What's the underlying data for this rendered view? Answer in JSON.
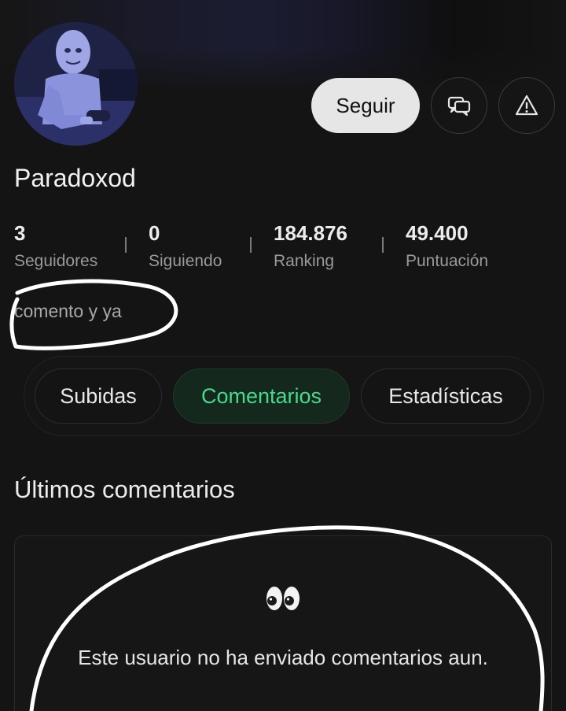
{
  "profile": {
    "username": "Paradoxod",
    "bio": "comento y ya",
    "follow_label": "Seguir"
  },
  "stats": [
    {
      "value": "3",
      "label": "Seguidores"
    },
    {
      "value": "0",
      "label": "Siguiendo"
    },
    {
      "value": "184.876",
      "label": "Ranking"
    },
    {
      "value": "49.400",
      "label": "Puntuación"
    }
  ],
  "tabs": [
    {
      "label": "Subidas",
      "active": false
    },
    {
      "label": "Comentarios",
      "active": true
    },
    {
      "label": "Estadísticas",
      "active": false
    }
  ],
  "comments": {
    "title": "Últimos comentarios",
    "empty_icon": "eyes-emoji",
    "empty_message": "Este usuario no ha enviado comentarios aun."
  },
  "icons": {
    "message": "chat-bubbles-icon",
    "report": "warning-triangle-icon"
  },
  "colors": {
    "background": "#141414",
    "accent": "#47d98c",
    "follow_button": "#e6e6e6"
  }
}
